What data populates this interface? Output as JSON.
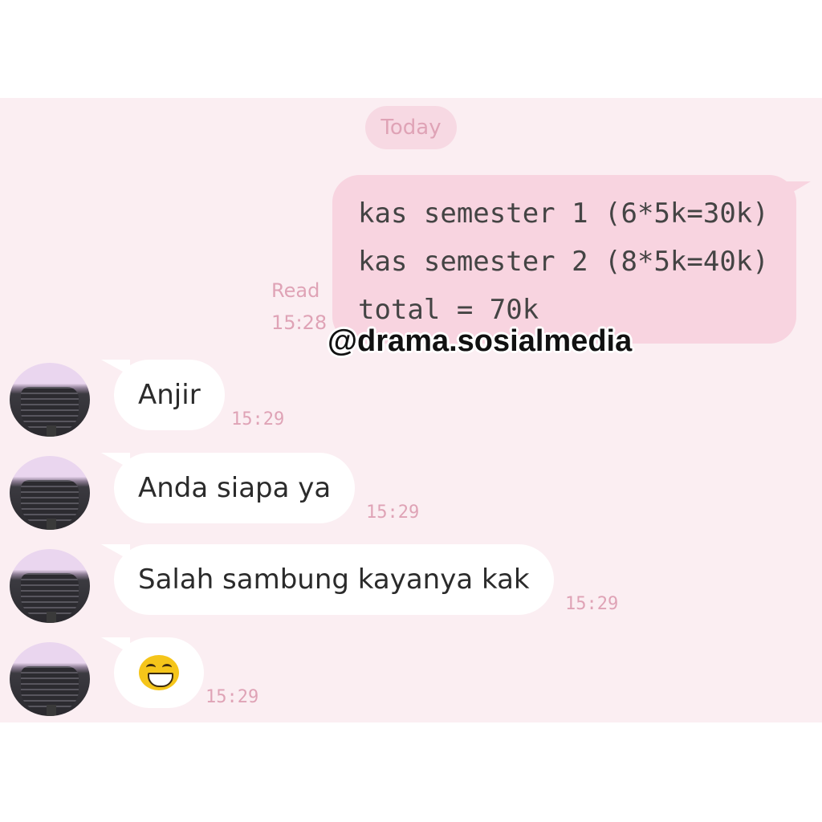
{
  "date_label": "Today",
  "outgoing": {
    "lines": [
      "kas semester 1 (6*5k=30k)",
      "kas semester 2 (8*5k=40k)",
      "total = 70k"
    ],
    "status": "Read",
    "time": "15:28"
  },
  "watermark": "@drama.sosialmedia",
  "incoming": [
    {
      "text": "Anjir",
      "time": "15:29"
    },
    {
      "text": "Anda siapa ya",
      "time": "15:29"
    },
    {
      "text": "Salah sambung kayanya kak",
      "time": "15:29"
    },
    {
      "text": "",
      "emoji": "grinning-squinting-face-icon",
      "time": "15:29"
    }
  ],
  "colors": {
    "chat_background": "#fbeef2",
    "outgoing_bubble": "#f8d4e0",
    "incoming_bubble": "#ffffff",
    "meta_text": "#dfa3b6"
  }
}
